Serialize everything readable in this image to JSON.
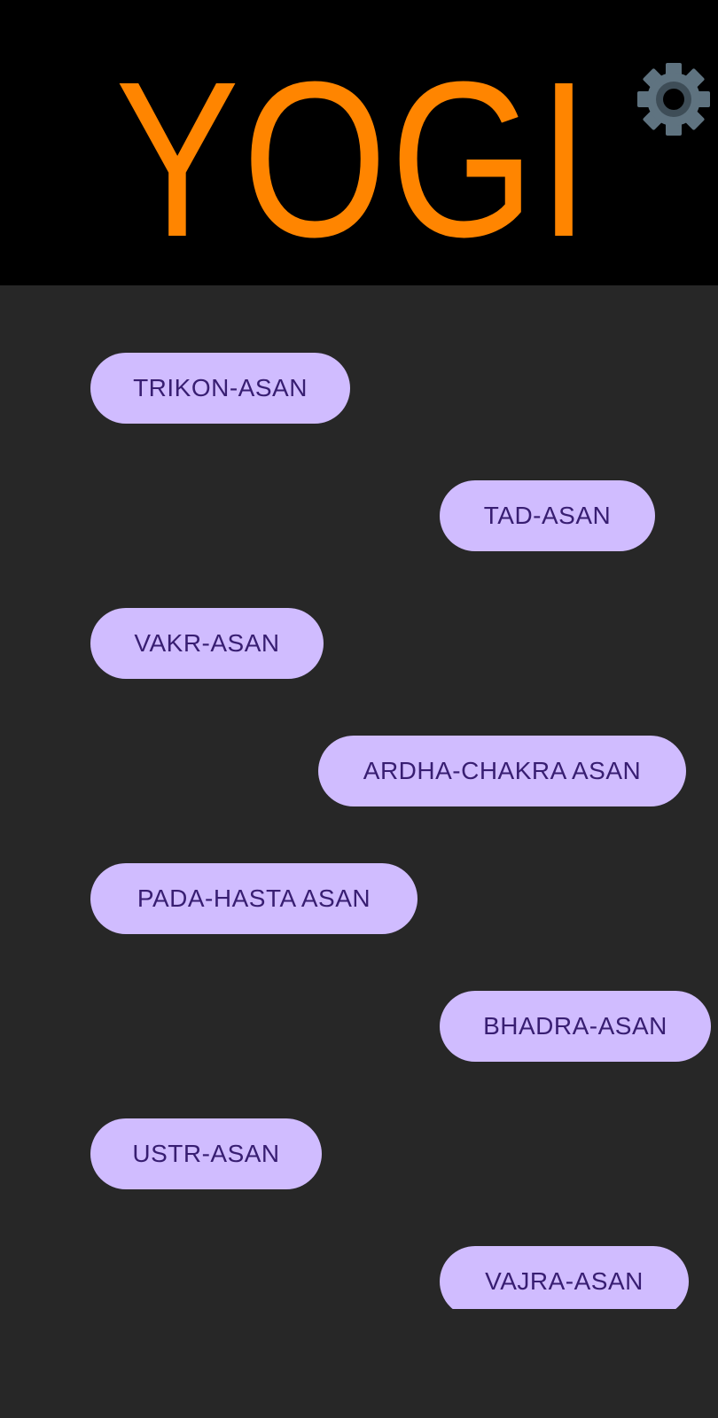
{
  "app": {
    "title": "YOGI",
    "title_color": "#FF8500",
    "header_bg": "#000000",
    "body_bg": "#272727",
    "settings_icon": "gear-icon"
  },
  "asans": {
    "button_bg": "#D0BCFF",
    "button_text_color": "#381E72",
    "items": [
      {
        "label": "TRIKON-ASAN"
      },
      {
        "label": "TAD-ASAN"
      },
      {
        "label": "VAKR-ASAN"
      },
      {
        "label": "ARDHA-CHAKRA ASAN"
      },
      {
        "label": "PADA-HASTA ASAN"
      },
      {
        "label": "BHADRA-ASAN"
      },
      {
        "label": "USTR-ASAN"
      },
      {
        "label": "VAJRA-ASAN"
      }
    ]
  }
}
